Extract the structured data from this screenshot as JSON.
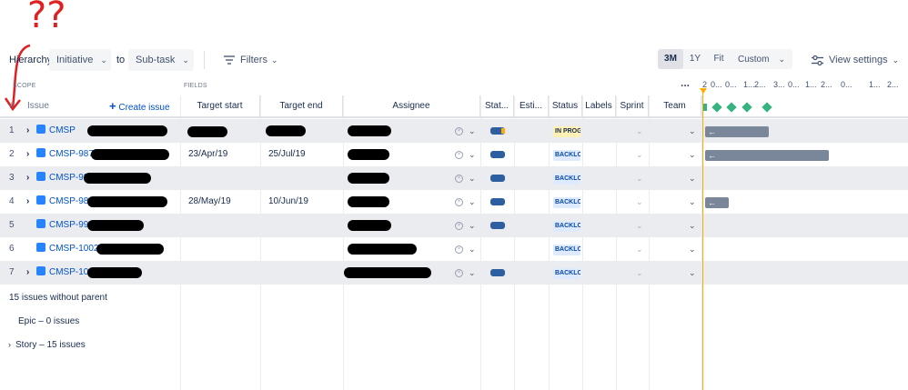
{
  "toolbar": {
    "hierarchy_label": "Hierarchy:",
    "from_value": "Initiative",
    "to_label": "to",
    "to_value": "Sub-task",
    "filters_label": "Filters",
    "zoom": [
      "3M",
      "1Y",
      "Fit",
      "Custom"
    ],
    "zoom_active": "3M",
    "view_settings_label": "View settings"
  },
  "sections": {
    "scope": "SCOPE",
    "fields": "FIELDS"
  },
  "columns": {
    "num": "#",
    "issue": "Issue",
    "create_issue": "Create issue",
    "target_start": "Target start",
    "target_end": "Target end",
    "assignee": "Assignee",
    "stat": "Stat...",
    "esti": "Esti...",
    "status": "Status",
    "labels": "Labels",
    "sprint": "Sprint",
    "team": "Team",
    "more": "..."
  },
  "timeline_header": [
    "2",
    "0...",
    "0...",
    "1...",
    "2...",
    "3...",
    "0...",
    "1...",
    "2...",
    "0...",
    "1...",
    "2..."
  ],
  "rows": [
    {
      "num": "1",
      "key": "CMSP",
      "expand": true,
      "start": "",
      "end": "",
      "status": "IN PROGRESS",
      "status_kind": "progress",
      "progress": true
    },
    {
      "num": "2",
      "key": "CMSP-987",
      "expand": true,
      "start": "23/Apr/19",
      "end": "25/Jul/19",
      "status": "BACKLOG",
      "status_kind": "backlog",
      "progress": true
    },
    {
      "num": "3",
      "key": "CMSP-988",
      "expand": true,
      "start": "",
      "end": "",
      "status": "BACKLOG",
      "status_kind": "backlog",
      "progress": true
    },
    {
      "num": "4",
      "key": "CMSP-989",
      "expand": true,
      "start": "28/May/19",
      "end": "10/Jun/19",
      "status": "BACKLOG",
      "status_kind": "backlog",
      "progress": true
    },
    {
      "num": "5",
      "key": "CMSP-990",
      "expand": false,
      "start": "",
      "end": "",
      "status": "BACKLOG",
      "status_kind": "backlog",
      "progress": true
    },
    {
      "num": "6",
      "key": "CMSP-1002",
      "expand": false,
      "start": "",
      "end": "",
      "status": "BACKLOG",
      "status_kind": "backlog",
      "progress": false
    },
    {
      "num": "7",
      "key": "CMSP-1003",
      "expand": true,
      "start": "",
      "end": "",
      "status": "BACKLOG",
      "status_kind": "backlog",
      "progress": true
    }
  ],
  "footer": {
    "without_parent": "15 issues without parent",
    "epic": "Epic – 0 issues",
    "story": "Story – 15 issues"
  },
  "timeline_bar_arrow": "←",
  "annotation_text": "??",
  "colors": {
    "accent": "#0052CC",
    "bar": "#7A869A",
    "milestone": "#36B37E",
    "today": "#FFAB00",
    "annotation": "#E02020"
  }
}
